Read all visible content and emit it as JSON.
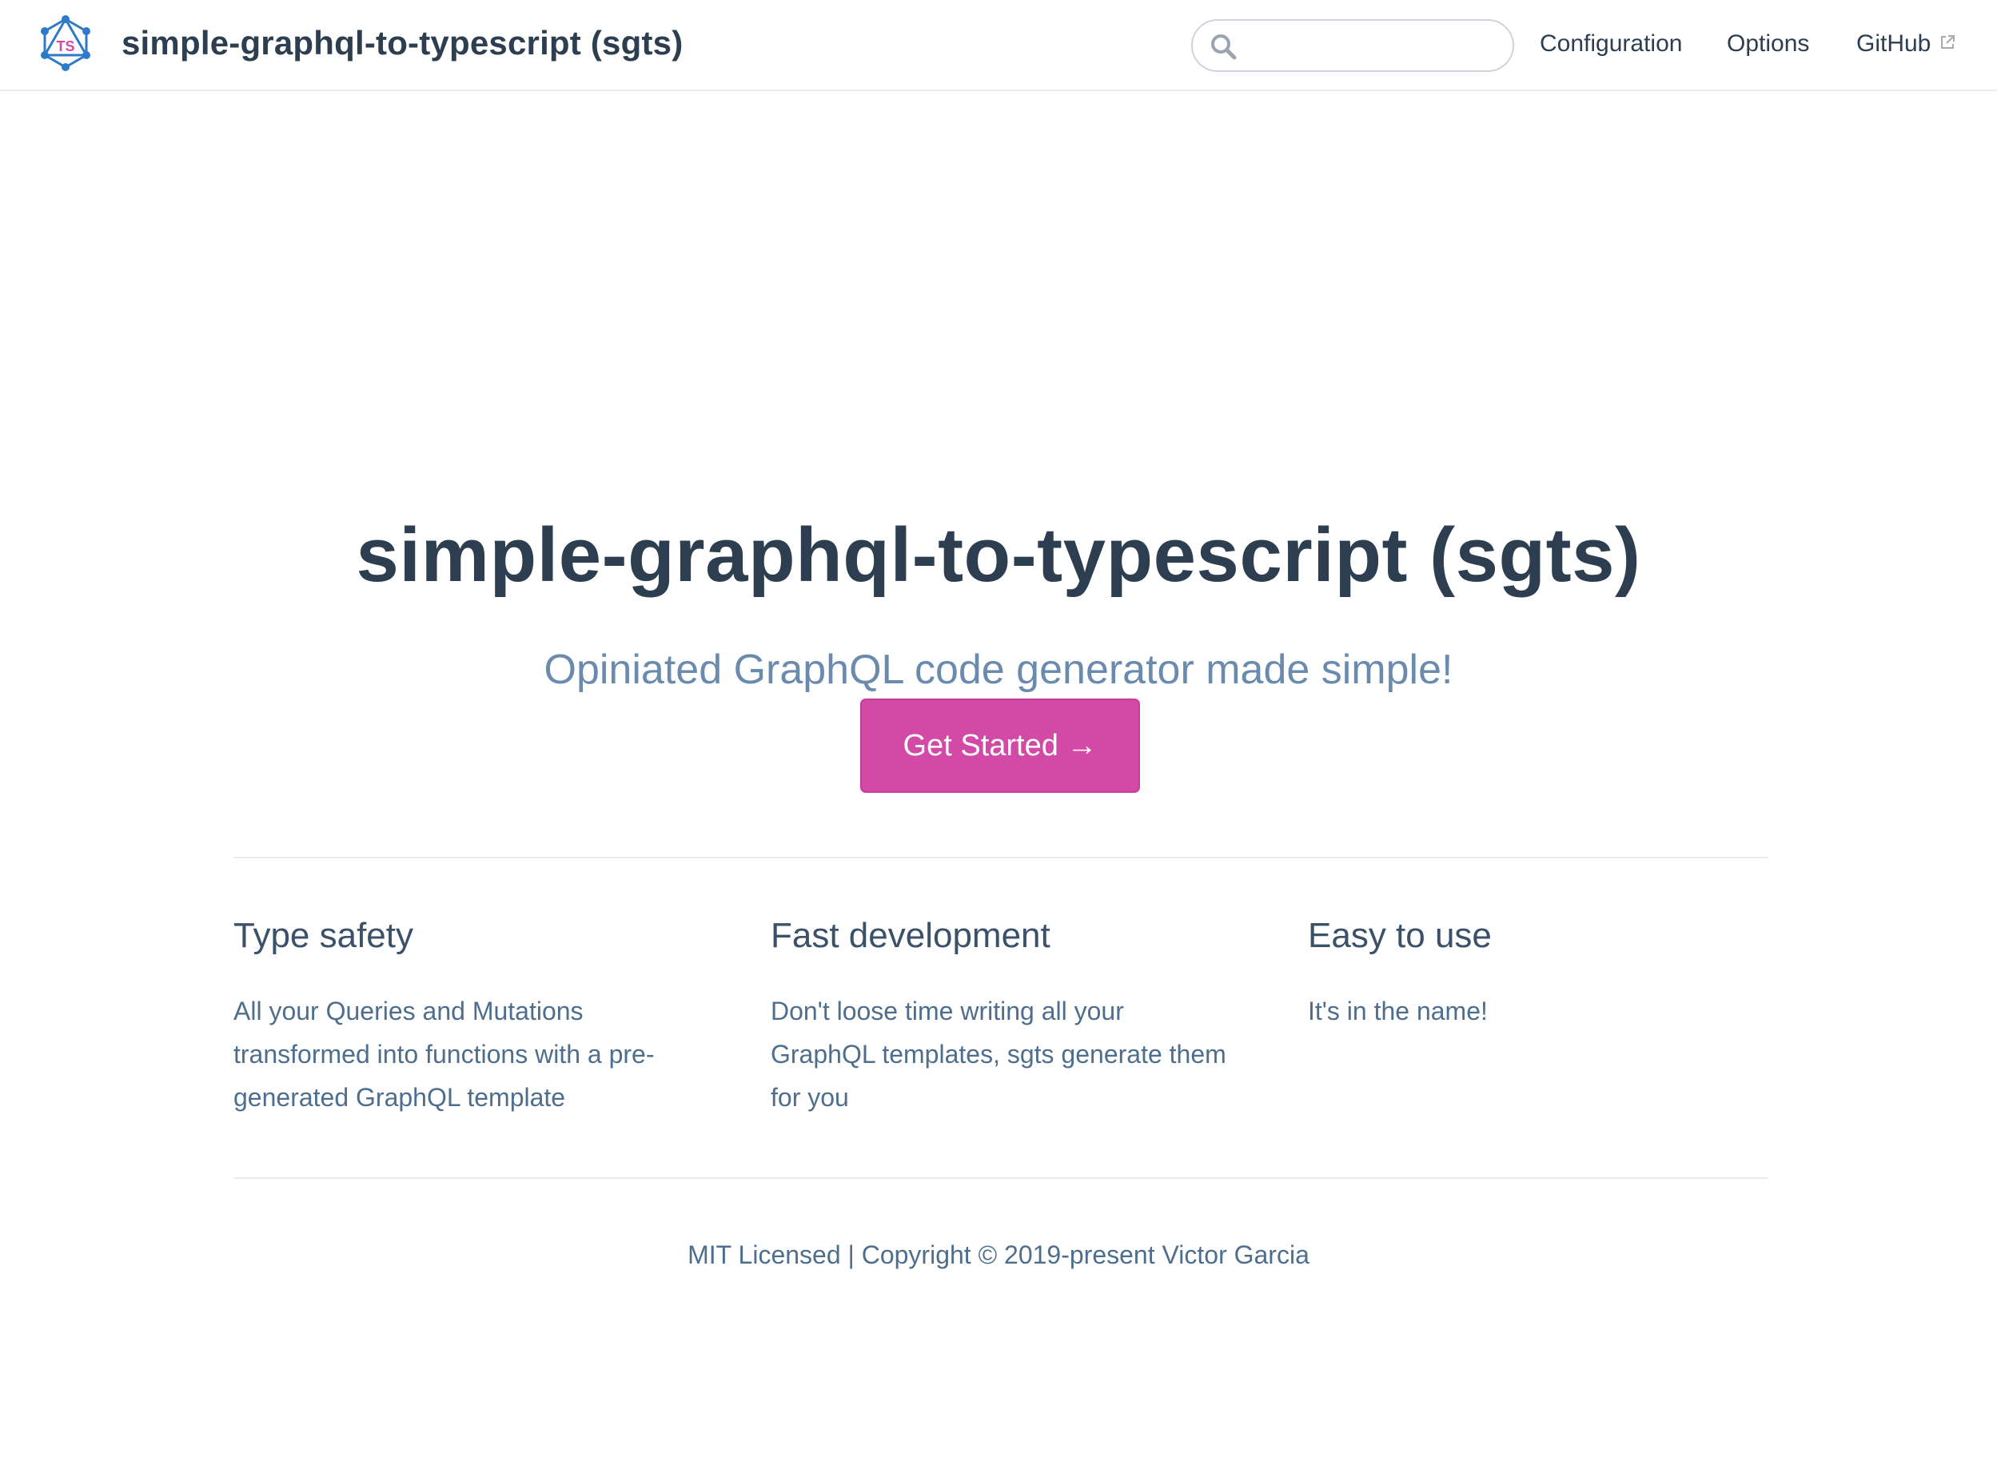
{
  "navbar": {
    "site_name": "simple-graphql-to-typescript (sgts)",
    "logo_text": "TS",
    "search": {
      "placeholder": "",
      "value": ""
    },
    "links": [
      {
        "label": "Configuration"
      },
      {
        "label": "Options"
      },
      {
        "label": "GitHub",
        "external": true
      }
    ]
  },
  "hero": {
    "title": "simple-graphql-to-typescript (sgts)",
    "description": "Opiniated GraphQL code generator made simple!",
    "action_text": "Get Started →"
  },
  "features": [
    {
      "title": "Type safety",
      "details": "All your Queries and Mutations transformed into functions with a pre-generated GraphQL template"
    },
    {
      "title": "Fast development",
      "details": "Don't loose time writing all your GraphQL templates, sgts generate them for you"
    },
    {
      "title": "Easy to use",
      "details": "It's in the name!"
    }
  ],
  "footer": {
    "text": "MIT Licensed | Copyright © 2019-present Victor Garcia"
  },
  "colors": {
    "accent": "#d34aa6",
    "text": "#2c3e50",
    "description": "#6a8bad",
    "logo_blue": "#2f7ac8",
    "logo_pink": "#d34aa6"
  },
  "icons": {
    "logo": "graphql-ts-logo-icon",
    "search": "search-icon",
    "external": "external-link-icon"
  }
}
